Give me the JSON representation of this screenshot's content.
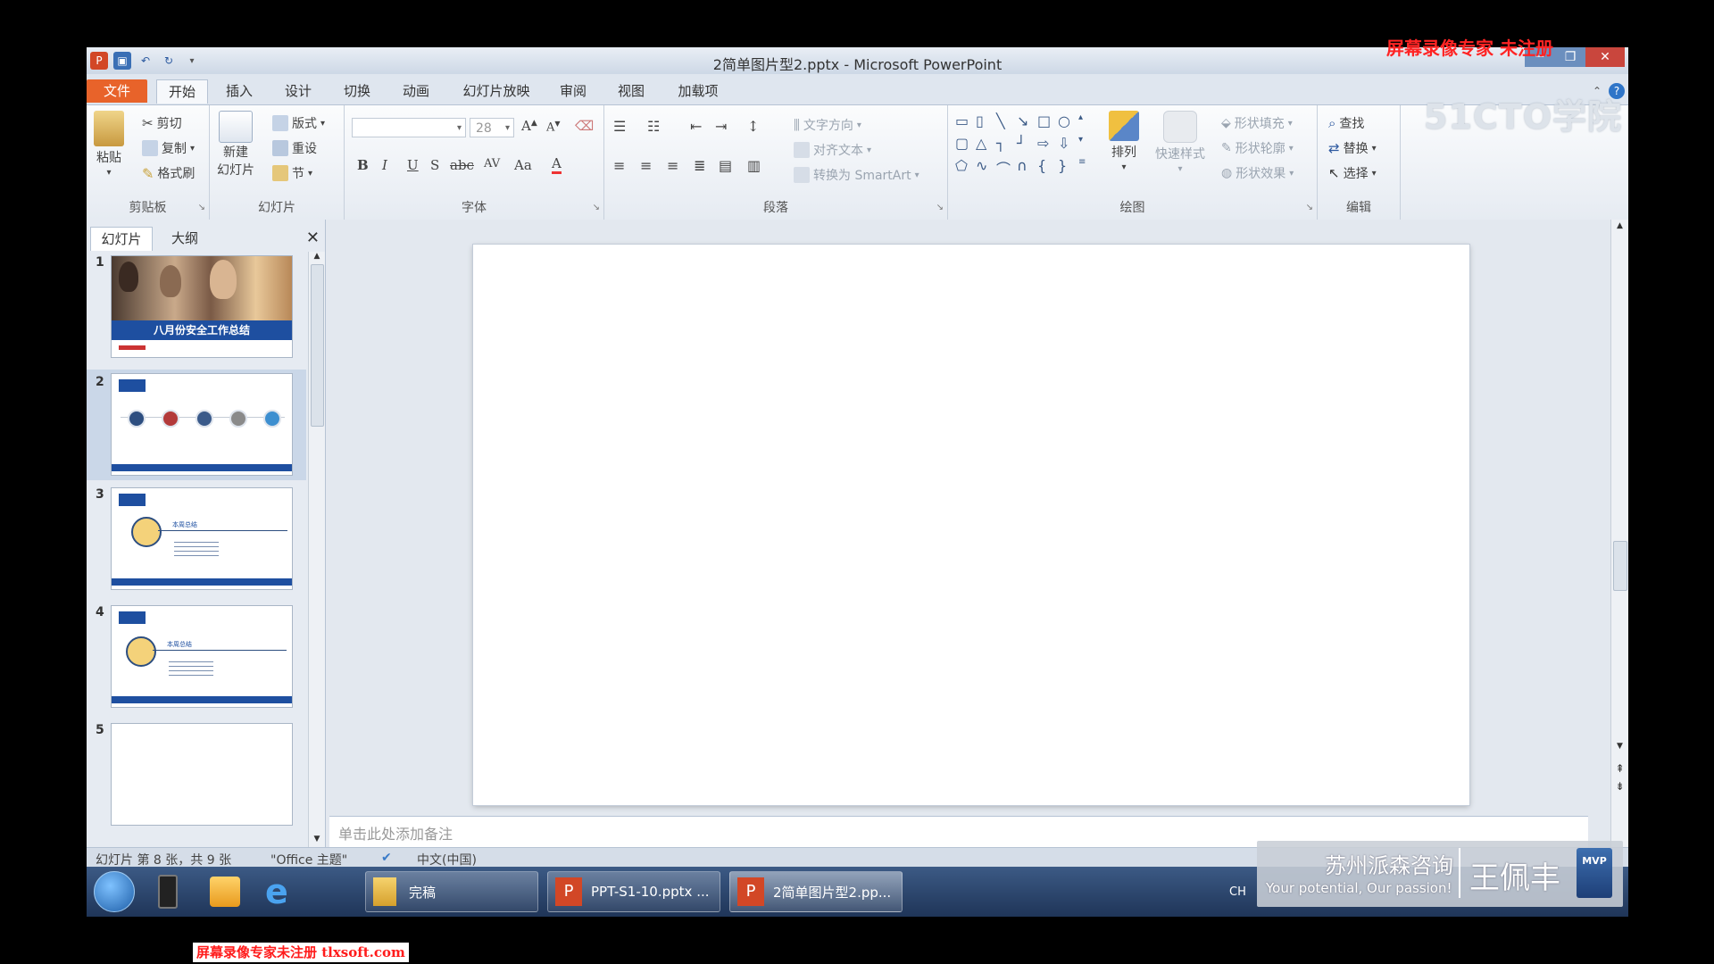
{
  "window": {
    "title": "2简单图片型2.pptx - Microsoft PowerPoint"
  },
  "tabs": [
    {
      "label": "文件"
    },
    {
      "label": "开始"
    },
    {
      "label": "插入"
    },
    {
      "label": "设计"
    },
    {
      "label": "切换"
    },
    {
      "label": "动画"
    },
    {
      "label": "幻灯片放映"
    },
    {
      "label": "审阅"
    },
    {
      "label": "视图"
    },
    {
      "label": "加载项"
    }
  ],
  "ribbon": {
    "clipboard": {
      "label": "剪贴板",
      "paste": "粘贴",
      "cut": "剪切",
      "copy": "复制",
      "format_painter": "格式刷"
    },
    "slides": {
      "label": "幻灯片",
      "new_slide_1": "新建",
      "new_slide_2": "幻灯片",
      "layout": "版式",
      "reset": "重设",
      "section": "节"
    },
    "font": {
      "label": "字体",
      "font_size": "28"
    },
    "paragraph": {
      "label": "段落",
      "text_direction": "文字方向",
      "align_text": "对齐文本",
      "convert_smartart": "转换为 SmartArt"
    },
    "drawing": {
      "label": "绘图",
      "arrange": "排列",
      "quick_styles": "快速样式",
      "shape_fill": "形状填充",
      "shape_outline": "形状轮廓",
      "shape_effects": "形状效果"
    },
    "editing": {
      "label": "编辑",
      "find": "查找",
      "replace": "替换",
      "select": "选择"
    }
  },
  "panel": {
    "tab_slides": "幻灯片",
    "tab_outline": "大纲",
    "thumbnails": [
      {
        "number": "1",
        "title": "八月份安全工作总结"
      },
      {
        "number": "2"
      },
      {
        "number": "3",
        "heading": "本周总结"
      },
      {
        "number": "4",
        "heading": "本周总结"
      },
      {
        "number": "5"
      }
    ]
  },
  "notes": {
    "placeholder": "单击此处添加备注"
  },
  "status": {
    "slide_count": "幻灯片 第 8 张，共 9 张",
    "theme": "\"Office 主题\"",
    "language": "中文(中国)"
  },
  "taskbar": {
    "explorer_label": "完稿",
    "ppt1_label": "PPT-S1-10.pptx ...",
    "ppt2_label": "2简单图片型2.pp...",
    "ime": "CH"
  },
  "watermarks": {
    "top_right": "屏幕录像专家 未注册",
    "footer": "屏幕录像专家未注册 tlxsoft.com",
    "logo": "51CTO学院"
  },
  "promo": {
    "company": "苏州派森咨询",
    "slogan": "Your potential, Our passion!",
    "name": "王佩丰",
    "badge": "MVP"
  },
  "colors": {
    "file_tab": "#e8632a",
    "accent_blue": "#1e4fa0",
    "taskbar": "#2a4470"
  }
}
